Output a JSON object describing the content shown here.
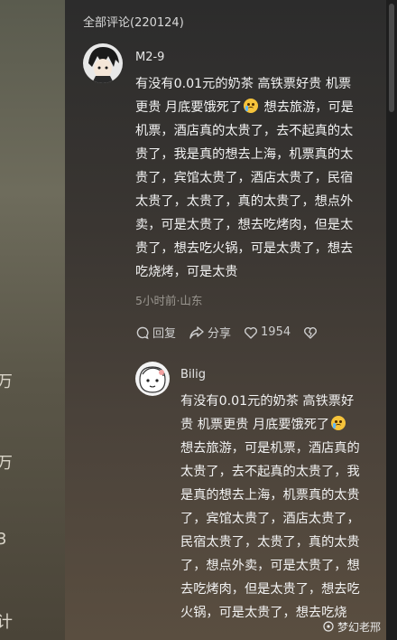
{
  "header": {
    "title": "全部评论(220124)"
  },
  "comments": [
    {
      "username": "M2-9",
      "text_before_emoji": "有没有0.01元的奶茶 高铁票好贵 机票\n更贵 月底要饿死了",
      "text_after_emoji": " 想去旅游，可是\n机票，酒店真的太贵了，去不起真的太\n贵了，我是真的想去上海，机票真的太\n贵了，宾馆太贵了，酒店太贵了，民宿\n太贵了，太贵了，真的太贵了，想点外\n卖，可是太贵了，想去吃烤肉，但是太\n贵了，想去吃火锅，可是太贵了，想去\n吃烧烤，可是太贵",
      "meta": "5小时前·山东",
      "reply_label": "回复",
      "share_label": "分享",
      "like_count": "1954"
    },
    {
      "username": "Bilig",
      "text_before_emoji": "有没有0.01元的奶茶 高铁票好\n贵 机票更贵 月底要饿死了",
      "text_after_emoji": "\n想去旅游，可是机票，酒店真的\n太贵了，去不起真的太贵了，我\n是真的想去上海，机票真的太贵\n了，宾馆太贵了，酒店太贵了，\n民宿太贵了，太贵了，真的太贵\n了，想点外卖，可是太贵了，想\n去吃烤肉，但是太贵了，想去吃\n火锅，可是太贵了，想去吃烧"
    }
  ],
  "watermark": "梦幻老邢",
  "left_strip_glyphs": [
    "万",
    "万",
    "3",
    "计"
  ],
  "colors": {
    "accent_text": "#f2f2f2",
    "meta": "#9a9690"
  }
}
